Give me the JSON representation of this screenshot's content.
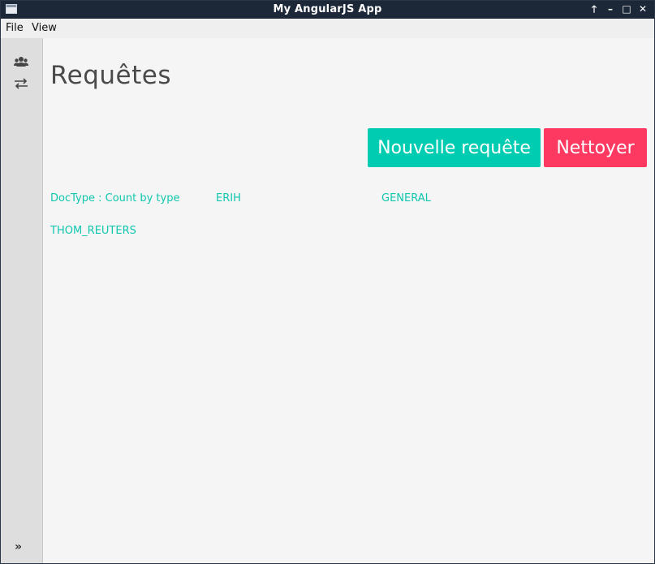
{
  "window": {
    "title": "My AngularJS App",
    "controls": {
      "restore": "🡑",
      "minimize": "–",
      "maximize": "□",
      "close": "✕"
    }
  },
  "menubar": {
    "items": [
      "File",
      "View"
    ]
  },
  "sidebar": {
    "icons": [
      "users-icon",
      "transfer-icon"
    ],
    "expand_label": "»"
  },
  "main": {
    "title": "Requêtes",
    "buttons": {
      "new_request": "Nouvelle requête",
      "clear": "Nettoyer"
    },
    "queries": [
      "DocType : Count by type",
      "ERIH",
      "GENERAL",
      "THOM_REUTERS"
    ]
  },
  "colors": {
    "accent": "#00ccb1",
    "danger": "#fd3961",
    "link": "#10c7ad",
    "titlebar": "#1c2838"
  }
}
